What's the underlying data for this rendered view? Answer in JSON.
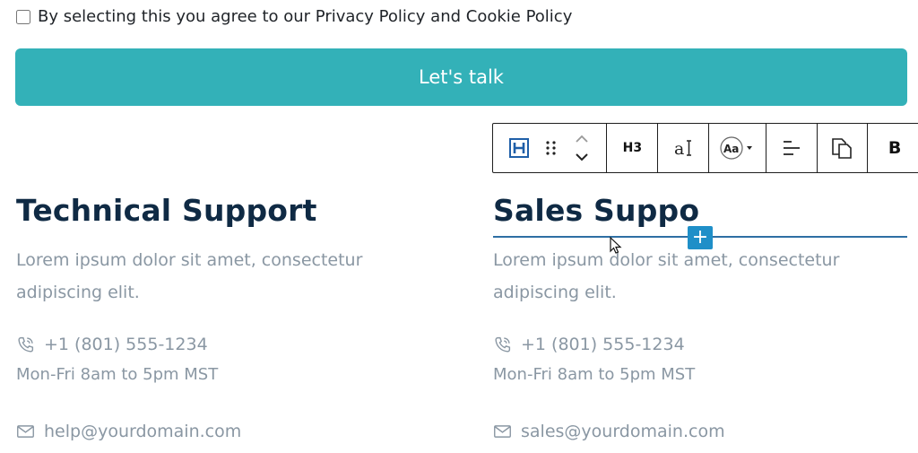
{
  "consent": {
    "label": "By selecting this you agree to our Privacy Policy and Cookie Policy"
  },
  "cta": {
    "label": "Let's talk"
  },
  "toolbar": {
    "level_label": "H3",
    "bold_label": "B"
  },
  "columns": [
    {
      "title": "Technical Support",
      "description": "Lorem ipsum dolor sit amet, consectetur adipiscing elit.",
      "phone": "+1 (801) 555-1234",
      "hours": "Mon-Fri 8am to 5pm MST",
      "email": "help@yourdomain.com"
    },
    {
      "title": "Sales Suppo",
      "description": "Lorem ipsum dolor sit amet, consectetur adipiscing elit.",
      "phone": "+1 (801) 555-1234",
      "hours": "Mon-Fri 8am to 5pm MST",
      "email": "sales@yourdomain.com"
    }
  ],
  "inserter": {
    "label": "+"
  },
  "colors": {
    "accent": "#33b1b8",
    "heading": "#0f2a44",
    "muted": "#8a97a3",
    "editor_blue": "#1f8fc8"
  }
}
